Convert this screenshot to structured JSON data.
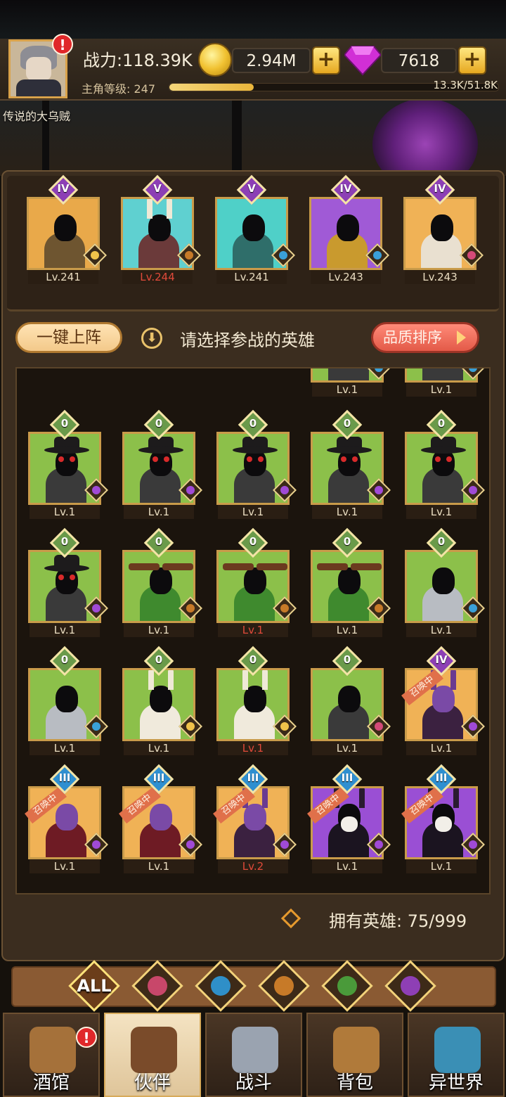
{
  "player": {
    "name": "传说的大乌贼",
    "power": "战力:118.39K",
    "level_label": "主角等级: 247",
    "xp_text": "13.3K/51.8K",
    "xp_progress": 0.257,
    "alert": "!"
  },
  "resources": {
    "gold": "2.94M",
    "gems": "7618",
    "plus": "+"
  },
  "team": [
    {
      "rank": "IV",
      "level": "Lv.241",
      "rank_color": "#8c3fb5",
      "bg": "#e9a94a",
      "body": "#6e5530",
      "faction": "elf",
      "red": false,
      "kind": "hood"
    },
    {
      "rank": "V",
      "level": "Lv.244",
      "rank_color": "#8c3fb5",
      "bg": "#5fd0d0",
      "body": "#6b3a3a",
      "faction": "beast",
      "red": true,
      "kind": "horns"
    },
    {
      "rank": "V",
      "level": "Lv.241",
      "rank_color": "#8c3fb5",
      "bg": "#4fd0c8",
      "body": "#2f6e6a",
      "faction": "sea",
      "red": false,
      "kind": "crown"
    },
    {
      "rank": "IV",
      "level": "Lv.243",
      "rank_color": "#8c3fb5",
      "bg": "#a05ad6",
      "body": "#c99a2e",
      "faction": "sea",
      "red": false,
      "kind": "hood"
    },
    {
      "rank": "IV",
      "level": "Lv.243",
      "rank_color": "#8c3fb5",
      "bg": "#f0b256",
      "body": "#e9e0d0",
      "faction": "light",
      "red": false,
      "kind": "crown"
    }
  ],
  "actions": {
    "one_click": "一键上阵",
    "hint": "请选择参战的英雄",
    "sort": "品质排序",
    "down_icon": "⬇"
  },
  "roster": [
    {
      "rank": "",
      "level": "Lv.1",
      "bg": "#8cc04a",
      "faction": "sea",
      "red": false,
      "kind": "partial",
      "summon": false
    },
    {
      "rank": "",
      "level": "Lv.1",
      "bg": "#8cc04a",
      "faction": "sea",
      "red": false,
      "kind": "partial",
      "summon": false
    },
    {
      "rank": "0",
      "level": "Lv.1",
      "bg": "#8cc04a",
      "faction": "demon",
      "red": false,
      "kind": "plague",
      "summon": false
    },
    {
      "rank": "0",
      "level": "Lv.1",
      "bg": "#8cc04a",
      "faction": "demon",
      "red": false,
      "kind": "plague",
      "summon": false
    },
    {
      "rank": "0",
      "level": "Lv.1",
      "bg": "#8cc04a",
      "faction": "demon",
      "red": false,
      "kind": "plague",
      "summon": false
    },
    {
      "rank": "0",
      "level": "Lv.1",
      "bg": "#8cc04a",
      "faction": "demon",
      "red": false,
      "kind": "plague",
      "summon": false
    },
    {
      "rank": "0",
      "level": "Lv.1",
      "bg": "#8cc04a",
      "faction": "demon",
      "red": false,
      "kind": "plague",
      "summon": false
    },
    {
      "rank": "0",
      "level": "Lv.1",
      "bg": "#8cc04a",
      "faction": "demon",
      "red": false,
      "kind": "plague",
      "summon": false
    },
    {
      "rank": "0",
      "level": "Lv.1",
      "bg": "#8cc04a",
      "faction": "beast",
      "red": false,
      "kind": "treant",
      "summon": false
    },
    {
      "rank": "0",
      "level": "Lv.1",
      "bg": "#8cc04a",
      "faction": "beast",
      "red": true,
      "kind": "treant",
      "summon": false
    },
    {
      "rank": "0",
      "level": "Lv.1",
      "bg": "#8cc04a",
      "faction": "beast",
      "red": false,
      "kind": "treant",
      "summon": false
    },
    {
      "rank": "0",
      "level": "Lv.1",
      "bg": "#8cc04a",
      "faction": "sea",
      "red": false,
      "kind": "knight",
      "summon": false
    },
    {
      "rank": "0",
      "level": "Lv.1",
      "bg": "#8cc04a",
      "faction": "sea",
      "red": false,
      "kind": "knight",
      "summon": false
    },
    {
      "rank": "0",
      "level": "Lv.1",
      "bg": "#8cc04a",
      "faction": "elf",
      "red": false,
      "kind": "horns",
      "summon": false
    },
    {
      "rank": "0",
      "level": "Lv.1",
      "bg": "#8cc04a",
      "faction": "elf",
      "red": true,
      "kind": "horns",
      "summon": false
    },
    {
      "rank": "0",
      "level": "Lv.1",
      "bg": "#8cc04a",
      "faction": "light",
      "red": false,
      "kind": "hood",
      "summon": false
    },
    {
      "rank": "IV",
      "level": "Lv.1",
      "bg": "#f0b256",
      "faction": "demon",
      "red": false,
      "kind": "demon",
      "summon": true
    },
    {
      "rank": "III",
      "level": "Lv.1",
      "bg": "#f0b256",
      "faction": "demon",
      "red": false,
      "kind": "spiky",
      "summon": true
    },
    {
      "rank": "III",
      "level": "Lv.1",
      "bg": "#f0b256",
      "faction": "demon",
      "red": false,
      "kind": "spiky",
      "summon": true
    },
    {
      "rank": "III",
      "level": "Lv.2",
      "bg": "#f0b256",
      "faction": "demon",
      "red": true,
      "kind": "demon",
      "summon": true
    },
    {
      "rank": "III",
      "level": "Lv.1",
      "bg": "#9a4fd4",
      "faction": "demon",
      "red": false,
      "kind": "skull",
      "summon": true
    },
    {
      "rank": "III",
      "level": "Lv.1",
      "bg": "#9a4fd4",
      "faction": "demon",
      "red": false,
      "kind": "skull",
      "summon": true
    }
  ],
  "summon_label": "召唤中",
  "owned": "拥有英雄: 75/999",
  "filters": [
    {
      "name": "all",
      "label": "ALL",
      "color": "#d9a24a"
    },
    {
      "name": "light",
      "label": "",
      "color": "#c8476a"
    },
    {
      "name": "sea",
      "label": "",
      "color": "#2f8fc8"
    },
    {
      "name": "beast",
      "label": "",
      "color": "#c77a28"
    },
    {
      "name": "elf",
      "label": "",
      "color": "#4a9a3a"
    },
    {
      "name": "demon",
      "label": "",
      "color": "#8e3fb5"
    }
  ],
  "nav": [
    {
      "name": "tavern",
      "label": "酒馆",
      "icon_color": "#a5713a",
      "alert": true,
      "active": false
    },
    {
      "name": "partner",
      "label": "伙伴",
      "icon_color": "#7a4b2a",
      "alert": false,
      "active": true
    },
    {
      "name": "battle",
      "label": "战斗",
      "icon_color": "#9aa3b0",
      "alert": false,
      "active": false
    },
    {
      "name": "bag",
      "label": "背包",
      "icon_color": "#b07a3a",
      "alert": false,
      "active": false
    },
    {
      "name": "otherworld",
      "label": "异世界",
      "icon_color": "#3a8fb5",
      "alert": false,
      "active": false
    }
  ],
  "colors": {
    "elf": "#f0c24a",
    "beast": "#c77a28",
    "sea": "#3aa0d8",
    "light": "#d44a78",
    "demon": "#a04ad6",
    "rank_gold": "#c99b4a",
    "rank_v": "#8c3fb5",
    "rank_iii": "#2f8fd0",
    "rank_0": "#6a9a4a"
  }
}
